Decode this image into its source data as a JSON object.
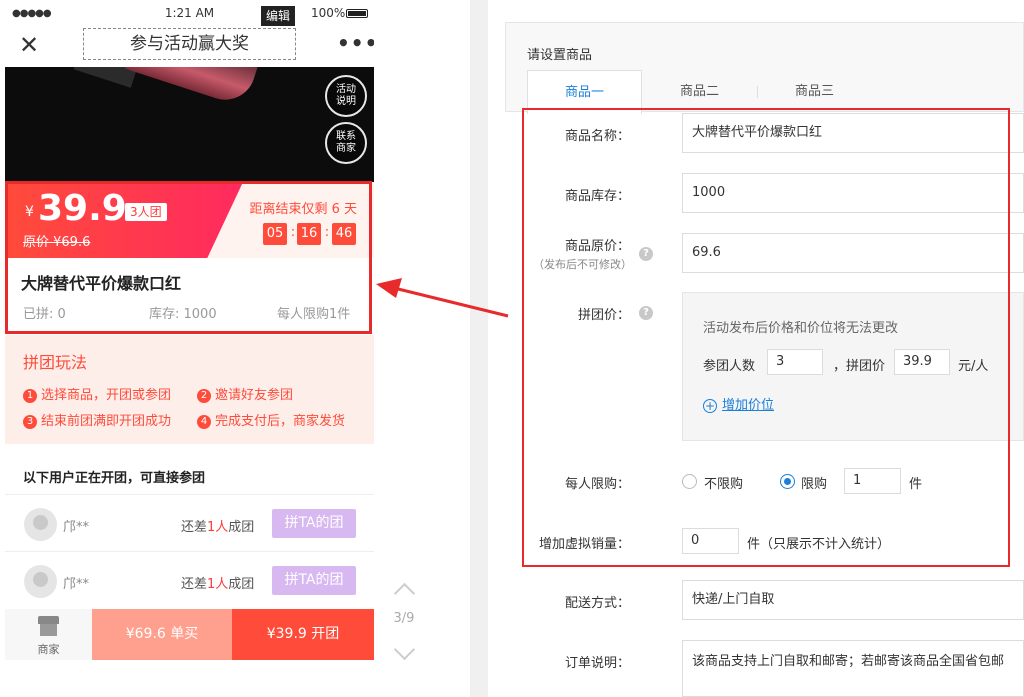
{
  "phone": {
    "status": {
      "signal": "●●●●●",
      "time": "1:21 AM",
      "edit": "编辑",
      "battery": "100%"
    },
    "nav": {
      "title": "参与活动赢大奖",
      "close": "✕",
      "more": "•••"
    },
    "banner_buttons": [
      "活动\n说明",
      "联系\n商家"
    ],
    "price": {
      "yen": "¥",
      "value": "39.9",
      "group_tag": "3人团",
      "original": "原价 ¥69.6",
      "countdown_label": "距离结束仅剩 6 天",
      "hours": "05",
      "minutes": "16",
      "seconds": "46"
    },
    "product": {
      "name": "大牌替代平价爆款口红",
      "joined": "已拼: 0",
      "stock": "库存: 1000",
      "limit": "每人限购1件"
    },
    "rules": {
      "title": "拼团玩法",
      "steps": [
        {
          "num": "1",
          "text": "选择商品，开团或参团"
        },
        {
          "num": "2",
          "text": "邀请好友参团"
        },
        {
          "num": "3",
          "text": "结束前团满即开团成功"
        },
        {
          "num": "4",
          "text": "完成支付后，商家发货"
        }
      ]
    },
    "groups": {
      "title": "以下用户正在开团，可直接参团",
      "rows": [
        {
          "user": "邝**",
          "need_prefix": "还差",
          "need_num": "1人",
          "need_suffix": "成团",
          "join": "拼TA的团"
        },
        {
          "user": "邝**",
          "need_prefix": "还差",
          "need_num": "1人",
          "need_suffix": "成团",
          "join": "拼TA的团"
        }
      ]
    },
    "bottom": {
      "shop": "商家",
      "single": "¥69.6 单买",
      "group": "¥39.9 开团"
    }
  },
  "pager": {
    "text": "3/9"
  },
  "form": {
    "section_title": "请设置商品",
    "tabs": [
      "商品一",
      "商品二",
      "商品三"
    ],
    "name_label": "商品名称：",
    "name_value": "大牌替代平价爆款口红",
    "stock_label": "商品库存：",
    "stock_value": "1000",
    "orig_label": "商品原价：",
    "orig_sub": "（发布后不可修改）",
    "orig_value": "69.6",
    "group_label": "拼团价：",
    "group_hint": "活动发布后价格和价位将无法更改",
    "people_label": "参团人数",
    "people_value": "3",
    "group_price_label": "，拼团价",
    "group_price_value": "39.9",
    "unit": "元/人",
    "add_price": "增加价位",
    "limit_label": "每人限购：",
    "limit_options": [
      "不限购",
      "限购"
    ],
    "limit_value": "1",
    "limit_unit": "件",
    "virtual_label": "增加虚拟销量：",
    "virtual_value": "0",
    "virtual_unit": "件（只展示不计入统计）",
    "delivery_label": "配送方式：",
    "delivery_value": "快递/上门自取",
    "note_label": "订单说明：",
    "note_value": "该商品支持上门自取和邮寄；若邮寄该商品全国省包邮"
  },
  "colors": {
    "accent_red": "#ff4b3a",
    "link_blue": "#1a7fd9",
    "highlight_border": "#e82a2a"
  }
}
